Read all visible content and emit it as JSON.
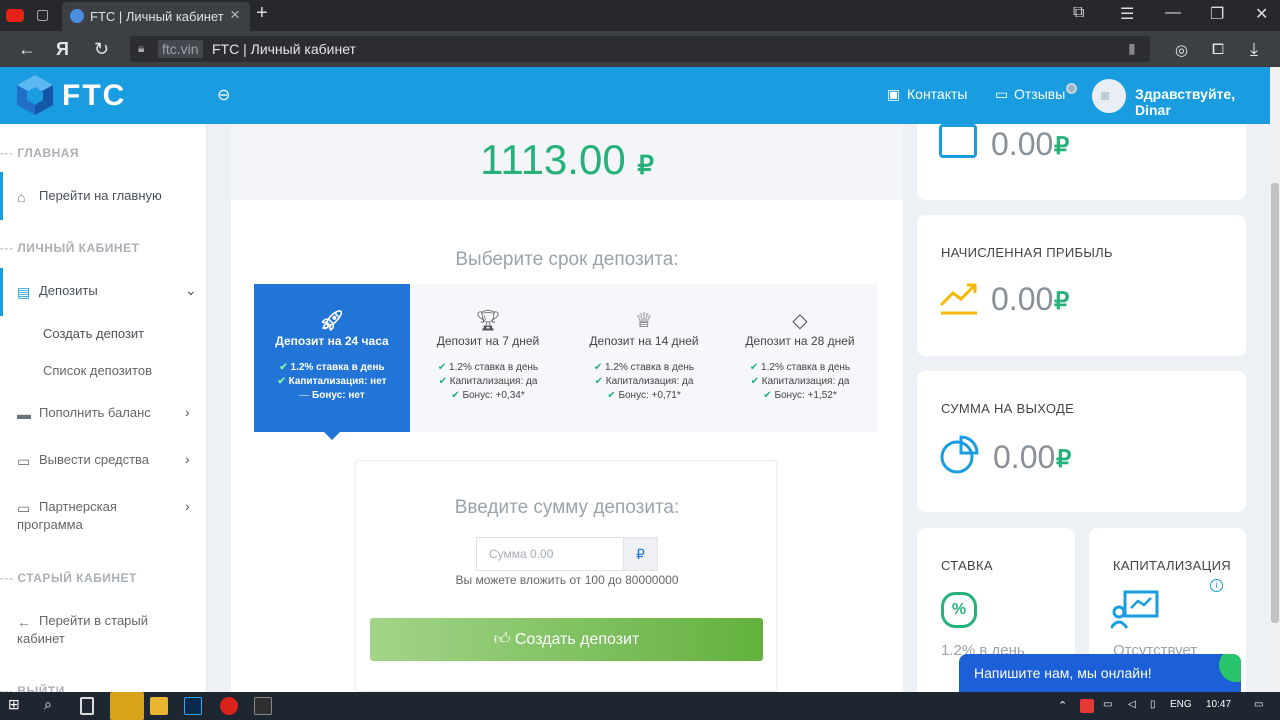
{
  "browser": {
    "tab_title": "FTC | Личный кабинет",
    "domain": "ftc.vin",
    "page_title": "FTC | Личный кабинет"
  },
  "header": {
    "logo": "FTC",
    "contacts": "Контакты",
    "reviews": "Отзывы",
    "greeting": "Здравствуйте, Dinar"
  },
  "sidebar": {
    "sections": [
      "ГЛАВНАЯ",
      "ЛИЧНЫЙ КАБИНЕТ",
      "СТАРЫЙ КАБИНЕТ",
      "ВЫЙТИ"
    ],
    "items": [
      {
        "label": "Перейти на главную"
      },
      {
        "label": "Депозиты"
      },
      {
        "label": "Создать депозит"
      },
      {
        "label": "Список депозитов"
      },
      {
        "label": "Пополнить баланс"
      },
      {
        "label": "Вывести средства"
      },
      {
        "label": "Партнерская"
      },
      {
        "label": "программа"
      },
      {
        "label": "Перейти в старый"
      },
      {
        "label": "кабинет"
      }
    ]
  },
  "main": {
    "balance": "1113.00",
    "currency": "₽",
    "choose_title": "Выберите срок депозита:",
    "plans": [
      {
        "title": "Депозит на 24 часа",
        "rate": "1.2% ставка в день",
        "cap": "Капитализация: нет",
        "bonus": "Бонус: нет"
      },
      {
        "title": "Депозит на 7 дней",
        "rate": "1.2% ставка в день",
        "cap": "Капитализация: да",
        "bonus": "Бонус: +0,34*"
      },
      {
        "title": "Депозит на 14 дней",
        "rate": "1.2% ставка в день",
        "cap": "Капитализация: да",
        "bonus": "Бонус: +0,71*"
      },
      {
        "title": "Депозит на 28 дней",
        "rate": "1.2% ставка в день",
        "cap": "Капитализация: да",
        "bonus": "Бонус: +1,52*"
      }
    ],
    "form_title": "Введите сумму депозита:",
    "input_placeholder": "Сумма 0.00",
    "input_addon": "₽",
    "limits": "Вы можете вложить от 100 до 80000000",
    "create_button": "Создать депозит"
  },
  "cards": {
    "invested_value": "0.00",
    "profit_title": "НАЧИСЛЕННАЯ ПРИБЫЛЬ",
    "profit_value": "0.00",
    "output_title": "СУММА НА ВЫХОДЕ",
    "output_value": "0.00",
    "rate_title": "СТАВКА",
    "rate_value": "1.2% в день",
    "cap_title": "КАПИТАЛИЗАЦИЯ",
    "cap_value": "Отсутствует",
    "currency": "₽"
  },
  "chat": {
    "label": "Напишите нам, мы онлайн!"
  },
  "taskbar": {
    "lang": "ENG",
    "time": "10:47"
  },
  "colors": {
    "accent": "#1a9de0",
    "green": "#27b17a",
    "plan_active": "#2275d7"
  }
}
